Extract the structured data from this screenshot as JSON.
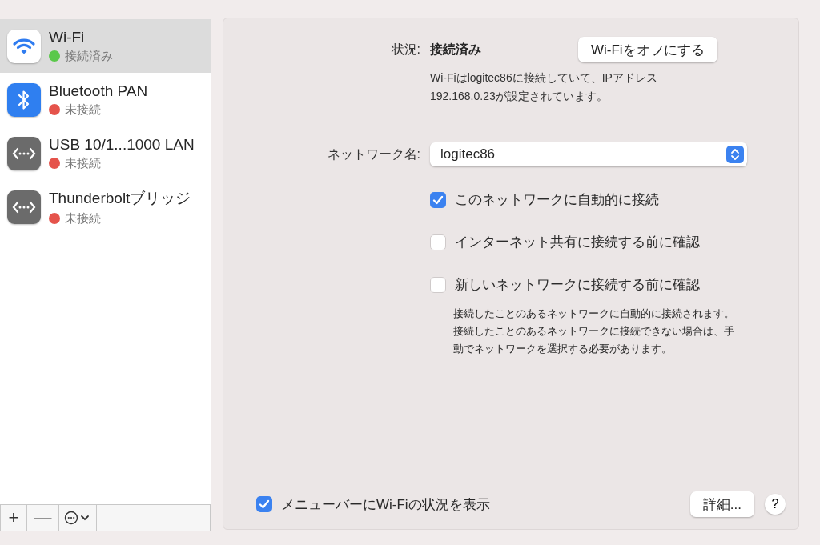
{
  "sidebar": {
    "items": [
      {
        "name": "Wi-Fi",
        "status": "接続済み",
        "color": "#5ac84a",
        "kind": "wifi",
        "selected": true
      },
      {
        "name": "Bluetooth PAN",
        "status": "未接続",
        "color": "#e5534b",
        "kind": "bluetooth",
        "selected": false
      },
      {
        "name": "USB 10/1...1000 LAN",
        "status": "未接続",
        "color": "#e5534b",
        "kind": "ethernet",
        "selected": false
      },
      {
        "name": "Thunderboltブリッジ",
        "status": "未接続",
        "color": "#e5534b",
        "kind": "ethernet",
        "selected": false
      }
    ],
    "buttons": [
      "+",
      "—"
    ]
  },
  "status": {
    "label": "状況:",
    "value": "接続済み",
    "button": "Wi-Fiをオフにする",
    "description": "Wi-Fiはlogitec86に接続していて、IPアドレス\n192.168.0.23が設定されています。"
  },
  "network": {
    "label": "ネットワーク名:",
    "value": "logitec86"
  },
  "options": [
    {
      "label": "このネットワークに自動的に接続",
      "checked": true
    },
    {
      "label": "インターネット共有に接続する前に確認",
      "checked": false
    },
    {
      "label": "新しいネットワークに接続する前に確認",
      "checked": false
    }
  ],
  "note": "接続したことのあるネットワークに自動的に接続されます。接続したことのあるネットワークに接続できない場合は、手動でネットワークを選択する必要があります。",
  "footer": {
    "menubar": {
      "label": "メニューバーにWi-Fiの状況を表示",
      "checked": true
    },
    "advanced": "詳細...",
    "help": "?"
  }
}
